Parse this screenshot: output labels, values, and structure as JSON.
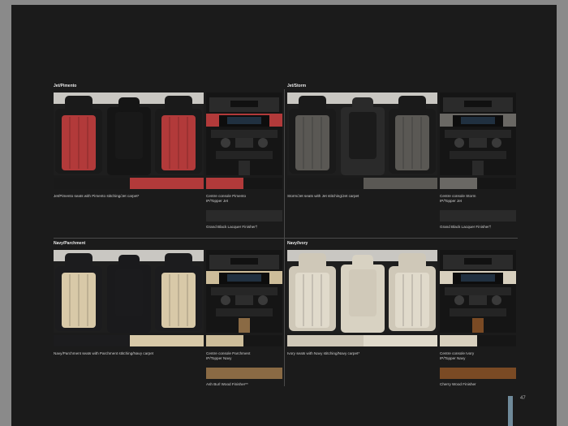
{
  "page_number": "47",
  "quadrants": [
    {
      "title": "Jet/Pimento",
      "seat_caption": "Jet/Pimento seats with Pimento stitching/Jet carpet*",
      "console_caption_1": "Centre console Pimento",
      "console_caption_2": "IP/Topper Jet",
      "finisher_caption": "Grand Black Lacquer Finisher†",
      "colors": {
        "seat_main": "#b23a3a",
        "seat_side": "#1a1a1a",
        "center": "#151515",
        "console_trim": "#b23a3a",
        "finisher": "#2a2a2a"
      }
    },
    {
      "title": "Jet/Storm",
      "seat_caption": "Storm/Jet seats with Jet stitching/Jet carpet",
      "console_caption_1": "Centre console Storm",
      "console_caption_2": "IP/Topper Jet",
      "finisher_caption": "Grand Black Lacquer Finisher†",
      "colors": {
        "seat_main": "#5a5854",
        "seat_side": "#1a1a1a",
        "center": "#2a2a2a",
        "console_trim": "#6a6864",
        "finisher": "#2a2a2a"
      }
    },
    {
      "title": "Navy/Parchment",
      "seat_caption": "Navy/Parchment seats with Parchment stitching/Navy carpet",
      "console_caption_1": "Centre console Parchment",
      "console_caption_2": "IP/Topper Navy",
      "finisher_caption": "Ash Burl Wood Finisher**",
      "colors": {
        "seat_main": "#d8c9a8",
        "seat_side": "#1c1c1e",
        "center": "#1a1a1c",
        "console_trim": "#cdbd9a",
        "finisher": "#8a6a44"
      }
    },
    {
      "title": "Navy/Ivory",
      "seat_caption": "Ivory seats with Navy stitching/Navy carpet*",
      "console_caption_1": "Centre console Ivory",
      "console_caption_2": "IP/Topper Navy",
      "finisher_caption": "Cherry Wood Finisher",
      "colors": {
        "seat_main": "#e0dacb",
        "seat_side": "#cfc8b8",
        "center": "#d8d2c2",
        "console_trim": "#d8d0be",
        "finisher": "#7a4a24"
      }
    }
  ]
}
